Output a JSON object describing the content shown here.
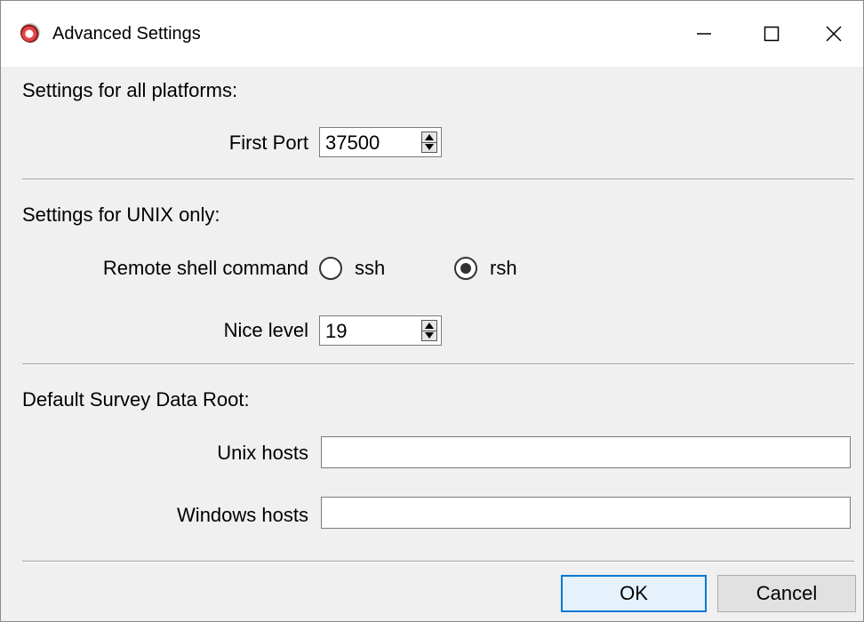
{
  "window": {
    "title": "Advanced Settings",
    "controls": [
      "minimize-icon",
      "maximize-icon",
      "close-icon"
    ]
  },
  "all_platforms": {
    "heading": "Settings for all platforms:",
    "first_port_label": "First Port",
    "first_port_value": "37500"
  },
  "unix": {
    "heading": "Settings for UNIX only:",
    "remote_shell_label": "Remote shell command",
    "options": [
      {
        "label": "ssh",
        "selected": false
      },
      {
        "label": "rsh",
        "selected": true
      }
    ],
    "nice_label": "Nice level",
    "nice_value": "19"
  },
  "survey_root": {
    "heading": "Default Survey Data Root:",
    "unix_hosts_label": "Unix hosts",
    "unix_hosts_value": "",
    "windows_hosts_label": "Windows hosts",
    "windows_hosts_value": ""
  },
  "buttons": {
    "ok": "OK",
    "cancel": "Cancel"
  },
  "colors": {
    "accent": "#0078d7",
    "dialog_bg": "#f0f0f0"
  }
}
